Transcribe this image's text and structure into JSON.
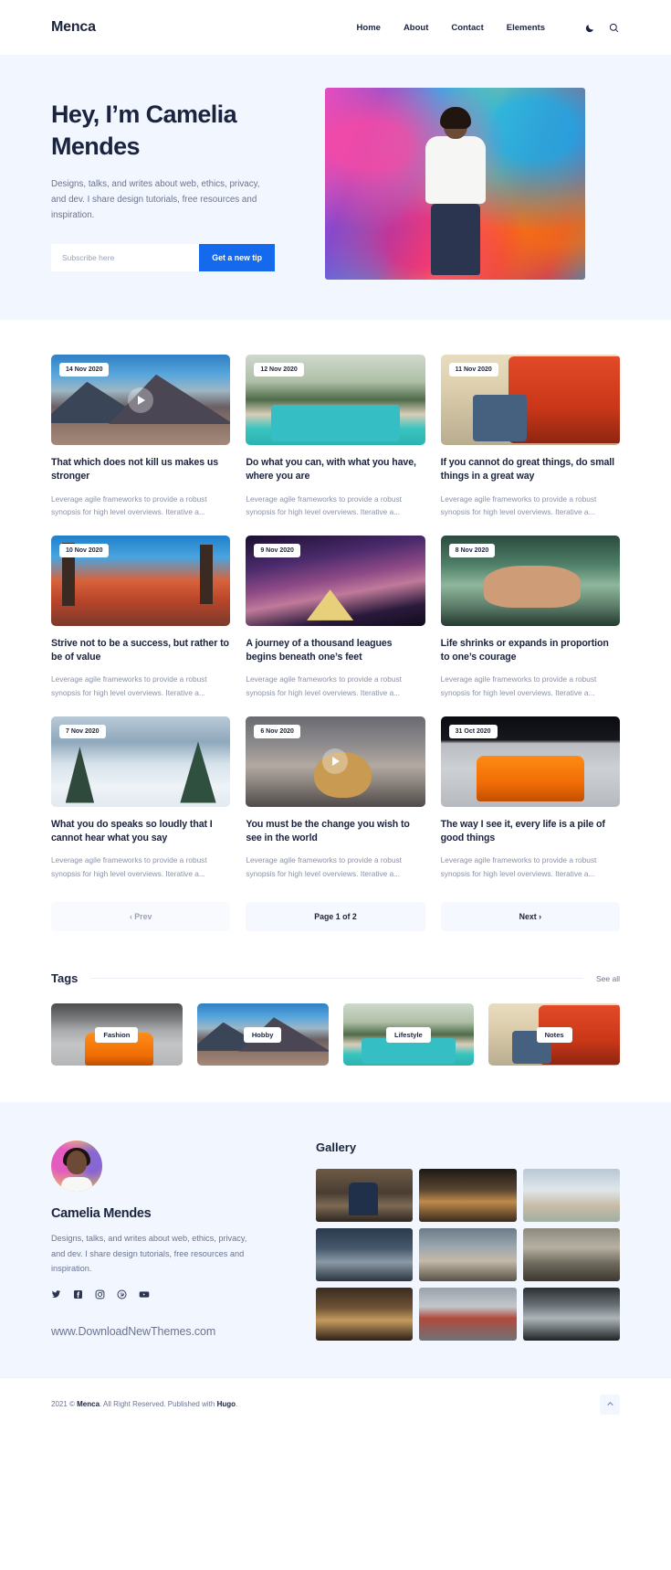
{
  "header": {
    "brand": "Menca",
    "nav": [
      {
        "label": "Home"
      },
      {
        "label": "About"
      },
      {
        "label": "Contact"
      },
      {
        "label": "Elements"
      }
    ],
    "theme_toggle_icon": "moon-icon",
    "search_icon": "search-icon"
  },
  "hero": {
    "title": "Hey, I’m Camelia Mendes",
    "subtitle": "Designs, talks, and writes about web, ethics, privacy, and dev. I share design tutorials, free resources and inspiration.",
    "email_placeholder": "Subscribe here",
    "email_value": "",
    "cta_label": "Get a new tip",
    "cta_color": "#1569ec",
    "background_color": "#f2f6ff",
    "photo_alt": "Camelia standing in front of colorful graffiti wall"
  },
  "posts": [
    {
      "date": "14 Nov 2020",
      "title": "That which does not kill us makes us stronger",
      "excerpt": "Leverage agile frameworks to provide a robust synopsis for high level overviews. Iterative a...",
      "image": "img-mountain",
      "has_video": true
    },
    {
      "date": "12 Nov 2020",
      "title": "Do what you can, with what you have, where you are",
      "excerpt": "Leverage agile frameworks to provide a robust synopsis for high level overviews. Iterative a...",
      "image": "img-pool",
      "has_video": false
    },
    {
      "date": "11 Nov 2020",
      "title": "If you cannot do great things, do small things in a great way",
      "excerpt": "Leverage agile frameworks to provide a robust synopsis for high level overviews. Iterative a...",
      "image": "img-van",
      "has_video": false
    },
    {
      "date": "10 Nov 2020",
      "title": "Strive not to be a success, but rather to be of value",
      "excerpt": "Leverage agile frameworks to provide a robust synopsis for high level overviews. Iterative a...",
      "image": "img-palm",
      "has_video": false
    },
    {
      "date": "9 Nov 2020",
      "title": "A journey of a thousand leagues begins beneath one’s feet",
      "excerpt": "Leverage agile frameworks to provide a robust synopsis for high level overviews. Iterative a...",
      "image": "img-galaxy",
      "has_video": false
    },
    {
      "date": "8 Nov 2020",
      "title": "Life shrinks or expands in proportion to one’s courage",
      "excerpt": "Leverage agile frameworks to provide a robust synopsis for high level overviews. Iterative a...",
      "image": "img-massage",
      "has_video": false
    },
    {
      "date": "7 Nov 2020",
      "title": "What you do speaks so loudly that I cannot hear what you say",
      "excerpt": "Leverage agile frameworks to provide a robust synopsis for high level overviews. Iterative a...",
      "image": "img-snow",
      "has_video": false
    },
    {
      "date": "6 Nov 2020",
      "title": "You must be the change you wish to see in the world",
      "excerpt": "Leverage agile frameworks to provide a robust synopsis for high level overviews. Iterative a...",
      "image": "img-dog",
      "has_video": true
    },
    {
      "date": "31 Oct 2020",
      "title": "The way I see it, every life is a pile of good things",
      "excerpt": "Leverage agile frameworks to provide a robust synopsis for high level overviews. Iterative a...",
      "image": "img-bmw",
      "has_video": false
    }
  ],
  "pagination": {
    "prev_label": "‹ Prev",
    "page_label": "Page 1 of 2",
    "next_label": "Next ›"
  },
  "tags_section": {
    "title": "Tags",
    "see_all_label": "See all",
    "tags": [
      {
        "label": "Fashion",
        "image": "img-gray-car"
      },
      {
        "label": "Hobby",
        "image": "img-mountain"
      },
      {
        "label": "Lifestyle",
        "image": "img-pool"
      },
      {
        "label": "Notes",
        "image": "img-van"
      }
    ]
  },
  "author": {
    "name": "Camelia Mendes",
    "bio": "Designs, talks, and writes about web, ethics, privacy, and dev. I share design tutorials, free resources and inspiration.",
    "website": "www.DownloadNewThemes.com",
    "socials": [
      {
        "name": "twitter-icon"
      },
      {
        "name": "facebook-icon"
      },
      {
        "name": "instagram-icon"
      },
      {
        "name": "pinterest-icon"
      },
      {
        "name": "youtube-icon"
      }
    ]
  },
  "gallery": {
    "title": "Gallery",
    "items": [
      {
        "image": "g1"
      },
      {
        "image": "g2"
      },
      {
        "image": "g3"
      },
      {
        "image": "g4"
      },
      {
        "image": "g5"
      },
      {
        "image": "g6"
      },
      {
        "image": "g7"
      },
      {
        "image": "g8"
      },
      {
        "image": "g9"
      }
    ]
  },
  "footer": {
    "copyright_prefix": "2021 © ",
    "brand": "Menca",
    "copyright_mid": ". All Right Reserved. Published with ",
    "platform": "Hugo",
    "copyright_suffix": ".",
    "to_top_icon": "chevron-up-icon"
  }
}
